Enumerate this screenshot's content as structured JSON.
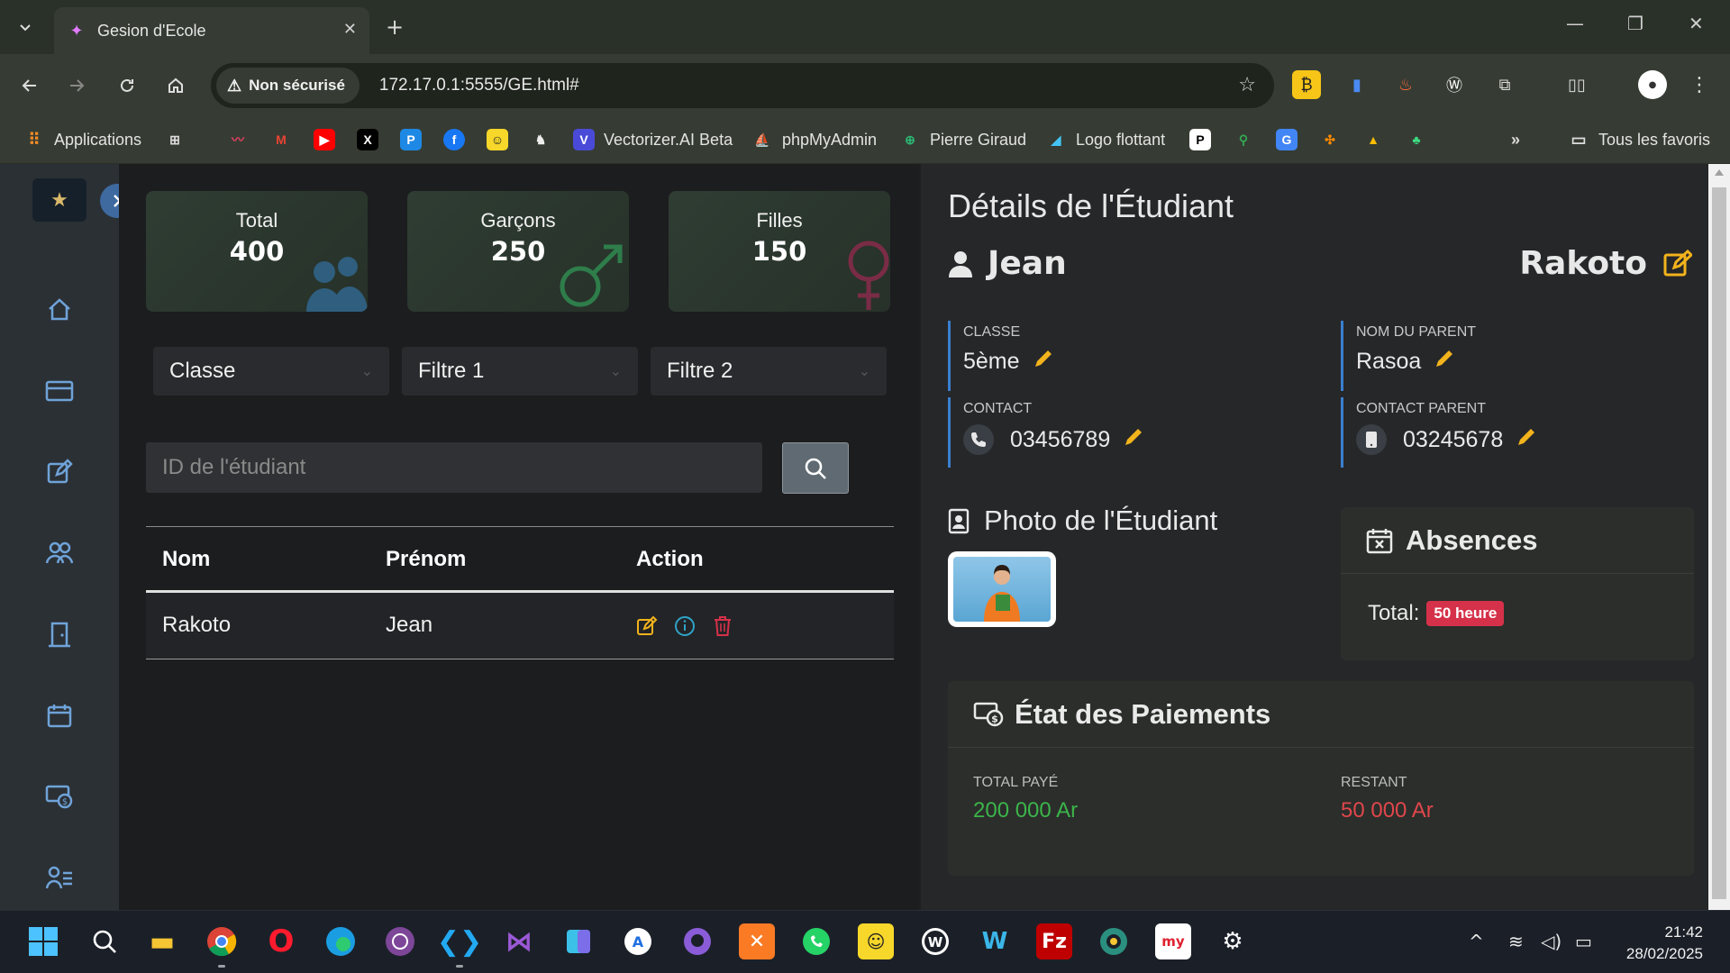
{
  "browser": {
    "tab_title": "Gesion d'Ecole",
    "security_label": "Non sécurisé",
    "url": "172.17.0.1:5555/GE.html#",
    "bookmarks": {
      "applications": "Applications",
      "vectorizer": "Vectorizer.AI Beta",
      "phpmyadmin": "phpMyAdmin",
      "pierre": "Pierre Giraud",
      "logo": "Logo flottant",
      "all_favorites": "Tous les favoris"
    }
  },
  "stats": [
    {
      "label": "Total",
      "value": "400"
    },
    {
      "label": "Garçons",
      "value": "250"
    },
    {
      "label": "Filles",
      "value": "150"
    }
  ],
  "filters": {
    "classe": "Classe",
    "filtre1": "Filtre 1",
    "filtre2": "Filtre 2"
  },
  "search": {
    "placeholder": "ID de l'étudiant"
  },
  "table": {
    "headers": {
      "nom": "Nom",
      "prenom": "Prénom",
      "action": "Action"
    },
    "rows": [
      {
        "nom": "Rakoto",
        "prenom": "Jean"
      }
    ]
  },
  "details": {
    "title": "Détails de l'Étudiant",
    "first_name": "Jean",
    "last_name": "Rakoto",
    "classe_label": "CLASSE",
    "classe_value": "5ème",
    "parent_label": "NOM DU PARENT",
    "parent_value": "Rasoa",
    "contact_label": "CONTACT",
    "contact_value": "03456789",
    "contact_parent_label": "CONTACT PARENT",
    "contact_parent_value": "03245678",
    "photo_title": "Photo de l'Étudiant",
    "absences_title": "Absences",
    "absences_total_label": "Total:",
    "absences_total_value": "50 heure",
    "payments_title": "État des Paiements",
    "total_paid_label": "TOTAL PAYÉ",
    "total_paid_value": "200 000 Ar",
    "remaining_label": "RESTANT",
    "remaining_value": "50 000 Ar"
  },
  "taskbar": {
    "time": "21:42",
    "date": "28/02/2025"
  },
  "colors": {
    "accent_blue": "#3a7fd0",
    "edit_yellow": "#f2b31c",
    "paid_green": "#3cb44b",
    "remaining_red": "#e0464b",
    "badge_red": "#d6314a"
  }
}
